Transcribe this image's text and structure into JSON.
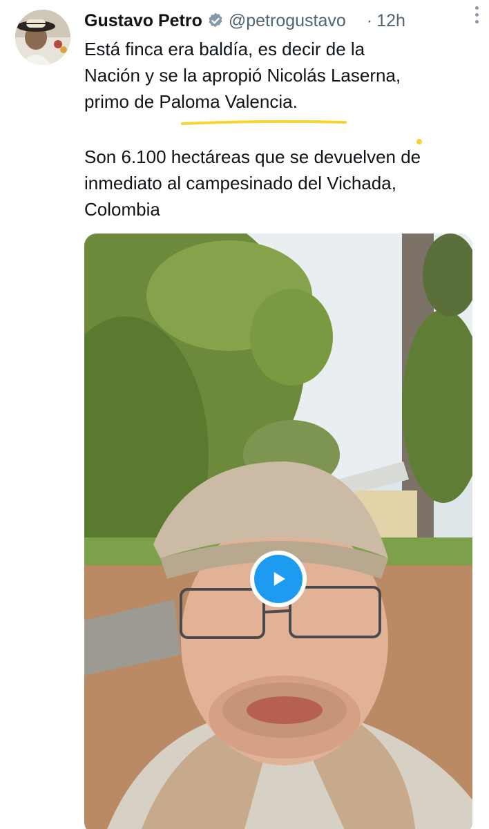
{
  "tweet": {
    "author_name": "Gustavo Petro",
    "author_handle": "@petrogustavo",
    "separator": "·",
    "timestamp": "12h",
    "verified": true,
    "paragraph1_lines": [
      "Está finca era baldía, es decir de la",
      "Nación y se la apropió Nicolás Laserna,",
      "primo de Paloma Valencia."
    ],
    "paragraph2_lines": [
      "Son 6.100 hectáreas que se devuelven de",
      "inmediato al campesinado del Vichada,",
      "Colombia"
    ]
  },
  "icons": {
    "verified": "verified-badge-icon",
    "more": "more-options-icon",
    "play": "play-icon"
  },
  "colors": {
    "text": "#0f1419",
    "secondary": "#536471",
    "accent": "#1d9bf0",
    "highlight_marker": "#f4d531"
  }
}
